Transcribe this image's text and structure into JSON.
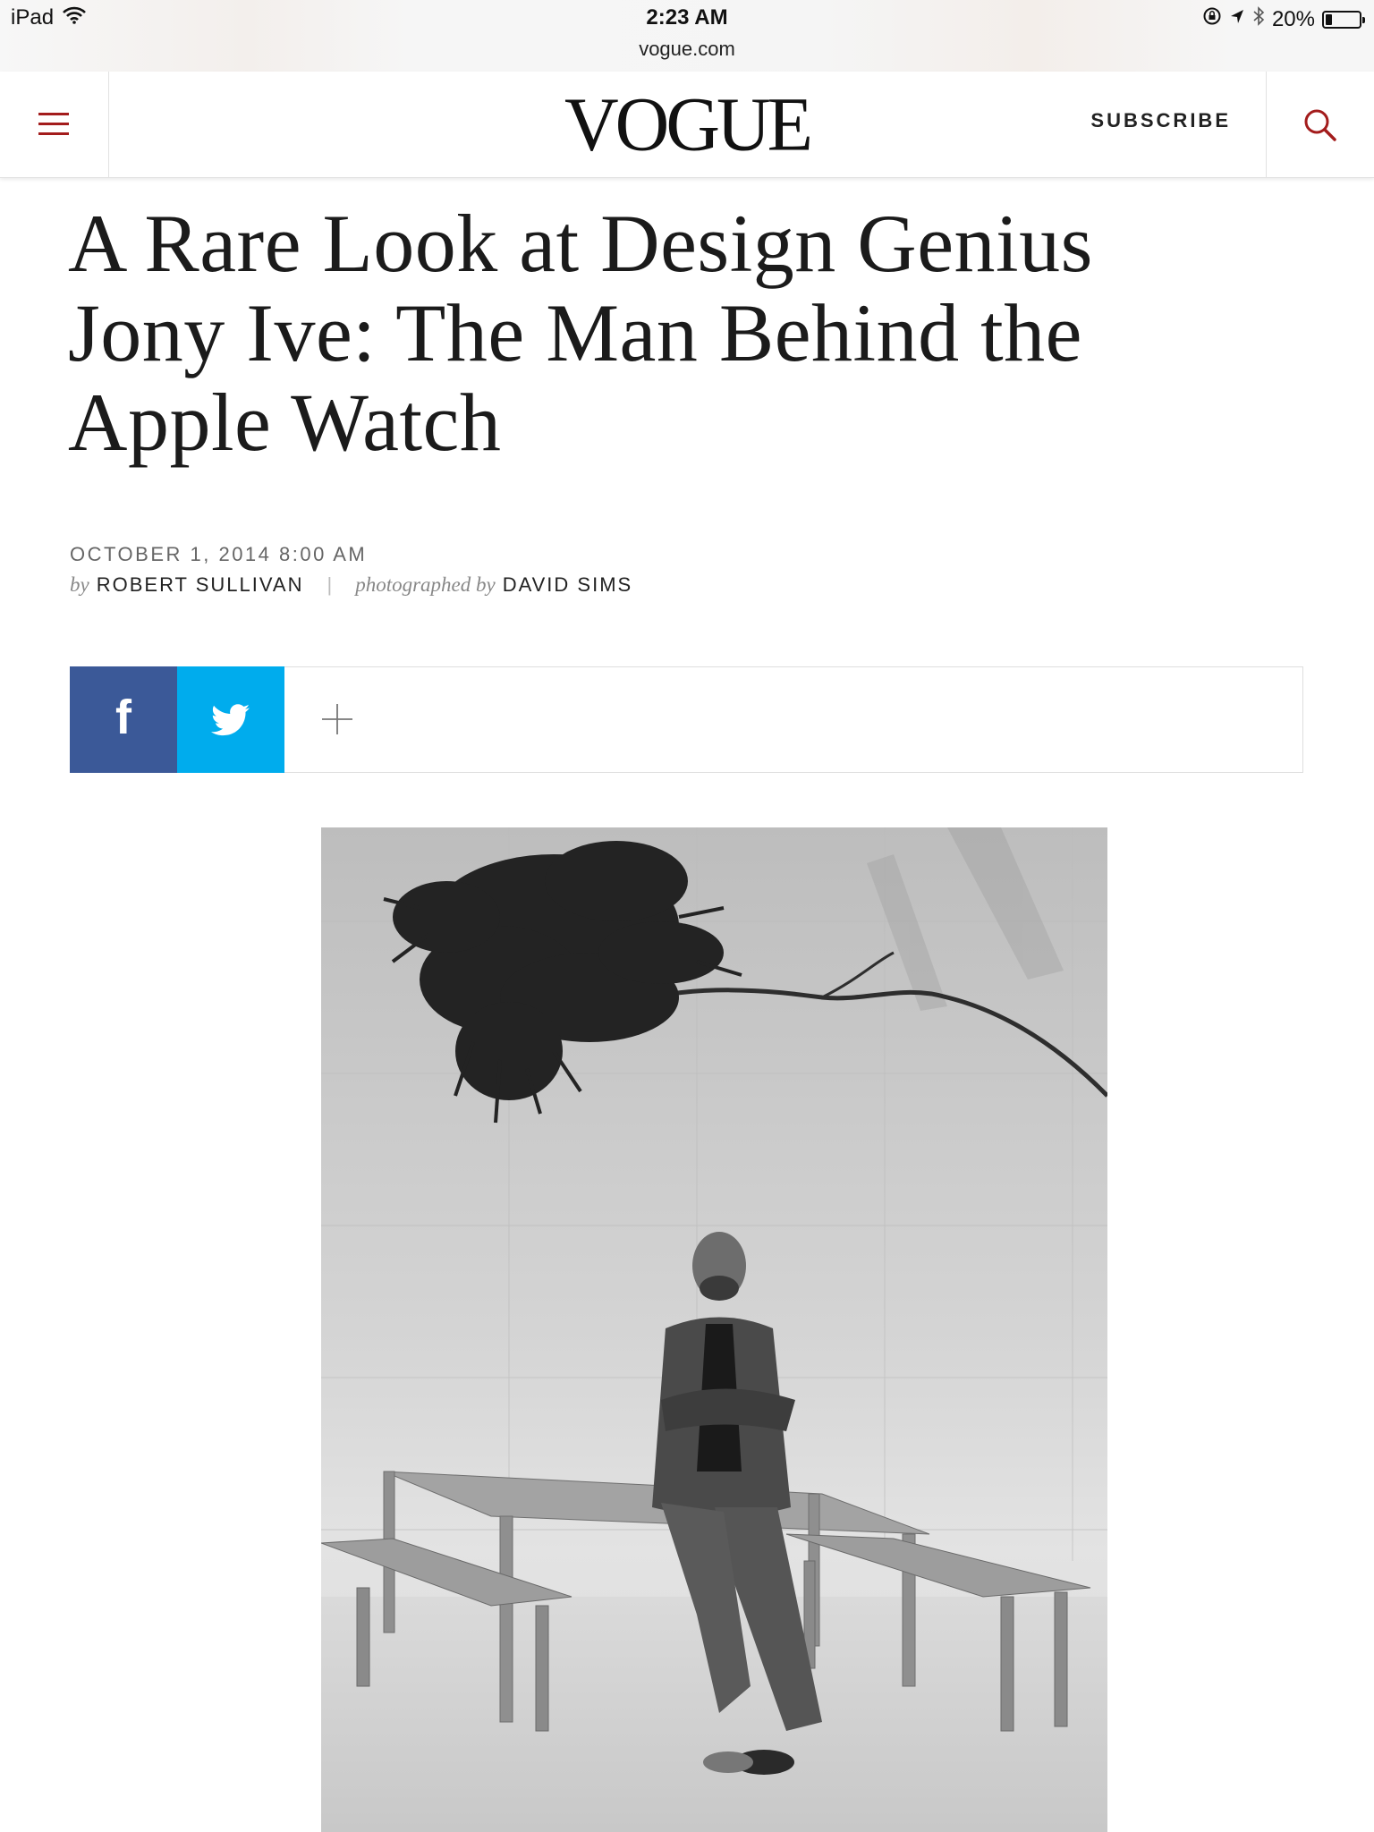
{
  "status_bar": {
    "device": "iPad",
    "time": "2:23 AM",
    "url": "vogue.com",
    "battery": "20%",
    "battery_level": 0.2,
    "icons": [
      "wifi-icon",
      "orientation-lock-icon",
      "location-arrow-icon",
      "bluetooth-icon",
      "battery-icon"
    ]
  },
  "header": {
    "logo": "VOGUE",
    "subscribe_label": "SUBSCRIBE",
    "menu_icon": "hamburger-menu-icon",
    "search_icon": "search-icon"
  },
  "article": {
    "title_line1": "A Rare Look at Design Genius",
    "title_line2": "Jony Ive: The Man Behind the",
    "title_line3": "Apple Watch",
    "date": "OCTOBER 1, 2014 8:00 AM",
    "by_label": "by",
    "author": "ROBERT SULLIVAN",
    "separator": "|",
    "photographed_label": "photographed by",
    "photographer": "DAVID SIMS"
  },
  "share": {
    "facebook_glyph": "f",
    "icons": [
      "facebook-icon",
      "twitter-icon",
      "plus-icon"
    ]
  },
  "colors": {
    "brand_red": "#a31c1c",
    "facebook": "#3b5998",
    "twitter": "#00aced"
  }
}
